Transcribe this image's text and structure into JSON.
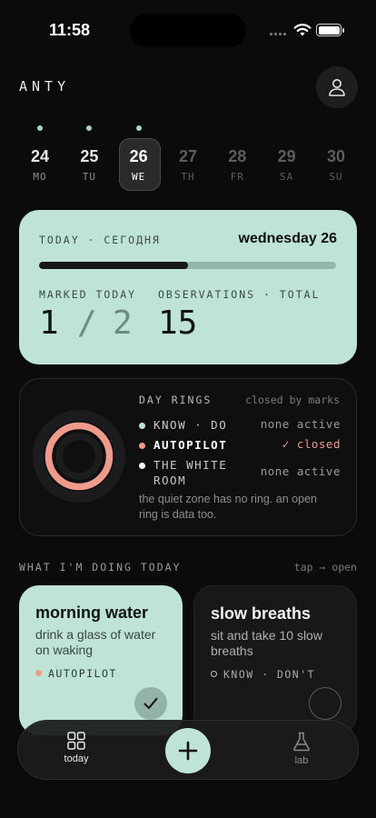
{
  "status": {
    "time": "11:58"
  },
  "header": {
    "brand": "ANTY",
    "profile_icon": "person-icon"
  },
  "week": [
    {
      "num": "24",
      "dn": "MO",
      "dot": true,
      "state": "past"
    },
    {
      "num": "25",
      "dn": "TU",
      "dot": true,
      "state": "past"
    },
    {
      "num": "26",
      "dn": "WE",
      "dot": true,
      "state": "selected"
    },
    {
      "num": "27",
      "dn": "TH",
      "dot": false,
      "state": "future"
    },
    {
      "num": "28",
      "dn": "FR",
      "dot": false,
      "state": "future"
    },
    {
      "num": "29",
      "dn": "SA",
      "dot": false,
      "state": "future"
    },
    {
      "num": "30",
      "dn": "SU",
      "dot": false,
      "state": "future"
    }
  ],
  "today": {
    "label": "TODAY · СЕГОДНЯ",
    "date": "wednesday 26",
    "progress_fraction": 0.5,
    "marked_label": "MARKED TODAY",
    "marked_count": "1",
    "slash": "/",
    "marked_total": "2",
    "observations_label": "OBSERVATIONS · TOTAL",
    "observations_total": "15"
  },
  "rings": {
    "title": "DAY RINGS",
    "subtitle": "closed by marks",
    "items": [
      {
        "name": "KNOW · DO",
        "state": "none active",
        "color": "#bfe3d6"
      },
      {
        "name": "AUTOPILOT",
        "state": "✓ closed",
        "color": "#ee9a8c"
      },
      {
        "name": "THE WHITE ROOM",
        "state": "none active",
        "color": "#ffffff"
      }
    ],
    "note": "the quiet zone has no ring. an open ring is data too."
  },
  "doing": {
    "title": "WHAT I'M DOING TODAY",
    "hint": "tap → open",
    "cards": [
      {
        "title": "morning water",
        "desc": "drink a glass of water on waking",
        "tag": "AUTOPILOT",
        "done": true
      },
      {
        "title": "slow breaths",
        "desc": "sit and take 10 slow breaths",
        "tag": "KNOW · DON'T",
        "done": false
      }
    ]
  },
  "nav": {
    "today": "today",
    "lab": "lab"
  },
  "colors": {
    "accent": "#bfe3d6",
    "ring_autopilot": "#ee9a8c",
    "background": "#0b0b0c"
  }
}
